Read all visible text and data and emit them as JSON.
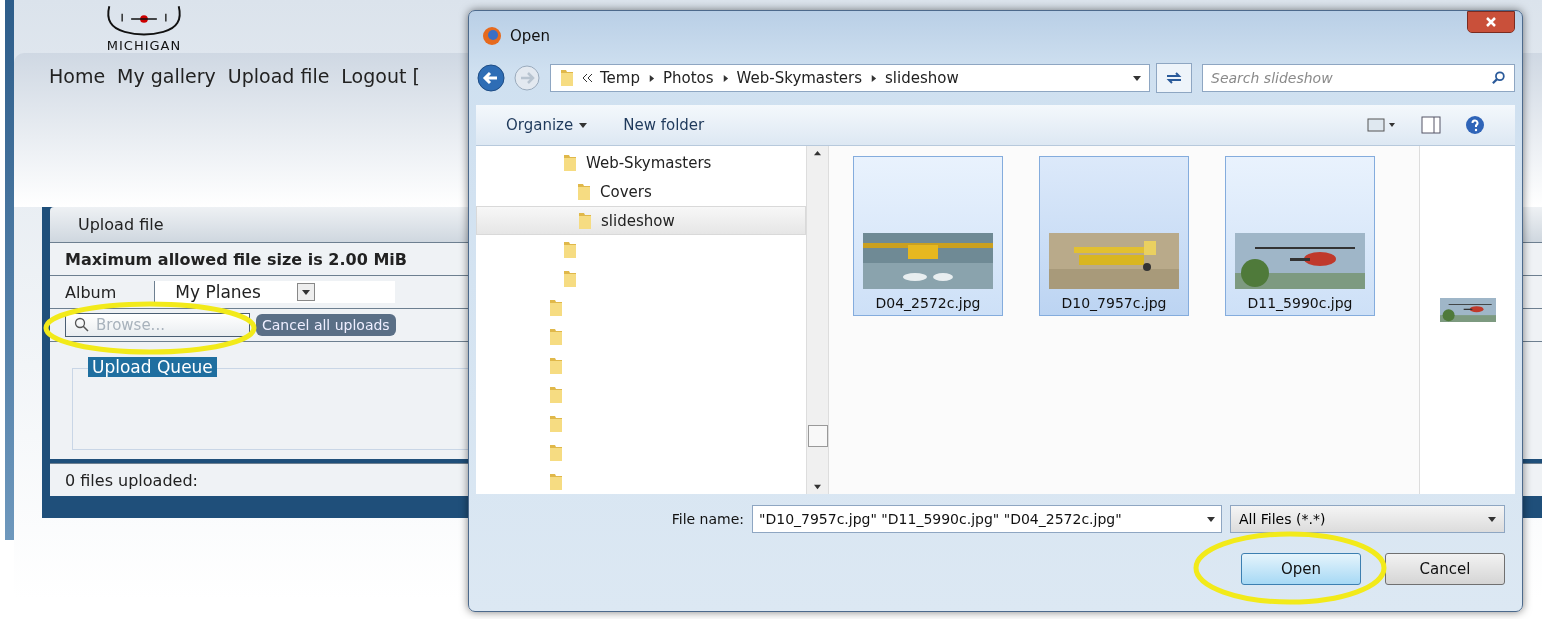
{
  "page": {
    "logo_text": "MICHIGAN",
    "nav": [
      "Home",
      "My gallery",
      "Upload file",
      "Logout ["
    ],
    "upload": {
      "title": "Upload file",
      "max_size": "Maximum allowed file size is 2.00 MiB",
      "album_label": "Album",
      "album_value": "My Planes",
      "browse_placeholder": "Browse...",
      "cancel_button": "Cancel all uploads",
      "queue_legend": "Upload Queue",
      "status": "0 files uploaded:"
    }
  },
  "dialog": {
    "title": "Open",
    "breadcrumb": [
      "Temp",
      "Photos",
      "Web-Skymasters",
      "slideshow"
    ],
    "search_placeholder": "Search slideshow",
    "toolbar": [
      "Organize",
      "New folder"
    ],
    "tree": [
      {
        "label": "Web-Skymasters",
        "selected": false,
        "children": [
          {
            "label": "Covers",
            "selected": false
          },
          {
            "label": "slideshow",
            "selected": true
          }
        ]
      },
      {
        "selected": false
      },
      {
        "selected": false
      }
    ],
    "tree_outer": [
      {
        "selected": false
      },
      {
        "selected": false
      },
      {
        "selected": false
      },
      {
        "selected": false
      },
      {
        "selected": false
      },
      {
        "selected": false
      },
      {
        "selected": false
      }
    ],
    "files": [
      {
        "name": "D04_2572c.jpg",
        "selected": true,
        "focused": false
      },
      {
        "name": "D10_7957c.jpg",
        "selected": true,
        "focused": true
      },
      {
        "name": "D11_5990c.jpg",
        "selected": true,
        "focused": false
      }
    ],
    "file_name_label": "File name:",
    "file_name_value": "\"D10_7957c.jpg\" \"D11_5990c.jpg\" \"D04_2572c.jpg\"",
    "filter": "All Files (*.*)",
    "buttons": [
      {
        "label": "Open",
        "kind": "default"
      },
      {
        "label": "Cancel",
        "kind": "normal"
      }
    ]
  }
}
